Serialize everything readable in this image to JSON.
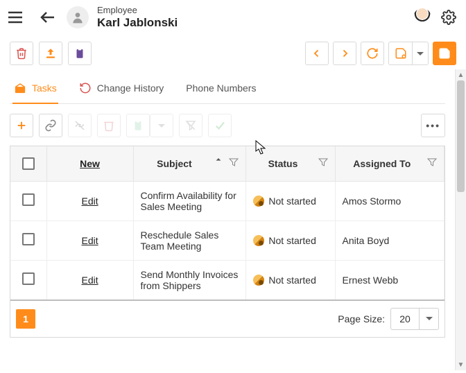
{
  "header": {
    "type_label": "Employee",
    "name": "Karl Jablonski"
  },
  "tabs": [
    {
      "id": "tasks",
      "label": "Tasks",
      "active": true
    },
    {
      "id": "history",
      "label": "Change History",
      "active": false
    },
    {
      "id": "phones",
      "label": "Phone Numbers",
      "active": false
    }
  ],
  "grid": {
    "new_link": "New",
    "edit_link": "Edit",
    "columns": {
      "subject": "Subject",
      "status": "Status",
      "assigned_to": "Assigned To"
    },
    "rows": [
      {
        "subject": "Confirm Availability for Sales Meeting",
        "status": "Not started",
        "assigned_to": "Amos Stormo"
      },
      {
        "subject": "Reschedule Sales Team Meeting",
        "status": "Not started",
        "assigned_to": "Anita Boyd"
      },
      {
        "subject": "Send Monthly Invoices from Shippers",
        "status": "Not started",
        "assigned_to": "Ernest Webb"
      }
    ]
  },
  "pager": {
    "current_page": "1",
    "page_size_label": "Page Size:",
    "page_size_value": "20"
  }
}
